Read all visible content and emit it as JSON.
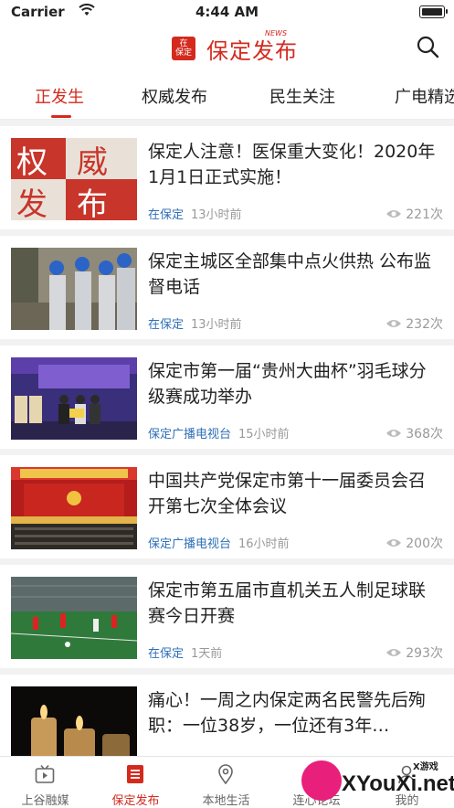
{
  "status_bar": {
    "carrier": "Carrier",
    "time": "4:44 AM"
  },
  "header": {
    "logo_badge_line1": "在",
    "logo_badge_line2": "保定",
    "logo_text": "保定发布",
    "logo_news": "NEWS",
    "search_icon": "search-icon"
  },
  "tabs": [
    {
      "label": "正发生",
      "active": true
    },
    {
      "label": "权威发布"
    },
    {
      "label": "民生关注"
    },
    {
      "label": "广电精选"
    }
  ],
  "feed": [
    {
      "title": "保定人注意！医保重大变化！2020年1月1日正式实施！",
      "source": "在保定",
      "time": "13小时前",
      "views": "221次",
      "thumb_text": "权威发布"
    },
    {
      "title": "保定主城区全部集中点火供热 公布监督电话",
      "source": "在保定",
      "time": "13小时前",
      "views": "232次"
    },
    {
      "title": "保定市第一届“贵州大曲杯”羽毛球分级赛成功举办",
      "source": "保定广播电视台",
      "time": "15小时前",
      "views": "368次"
    },
    {
      "title": "中国共产党保定市第十一届委员会召开第七次全体会议",
      "source": "保定广播电视台",
      "time": "16小时前",
      "views": "200次"
    },
    {
      "title": "保定市第五届市直机关五人制足球联赛今日开赛",
      "source": "在保定",
      "time": "1天前",
      "views": "293次"
    },
    {
      "title": "痛心！一周之内保定两名民警先后殉职：一位38岁，一位还有3年…",
      "source": "",
      "time": "",
      "views": ""
    }
  ],
  "tabbar": [
    {
      "label": "上谷融媒",
      "icon": "tv-icon"
    },
    {
      "label": "保定发布",
      "icon": "list-icon",
      "active": true
    },
    {
      "label": "本地生活",
      "icon": "location-icon"
    },
    {
      "label": "连心论坛",
      "icon": "chat-icon"
    },
    {
      "label": "我的",
      "icon": "user-icon"
    }
  ],
  "watermark": {
    "text": "XYouXi.net",
    "small": "X游戏"
  },
  "colors": {
    "accent": "#d42a1e",
    "source_link": "#2f6fb6",
    "muted": "#999999"
  }
}
